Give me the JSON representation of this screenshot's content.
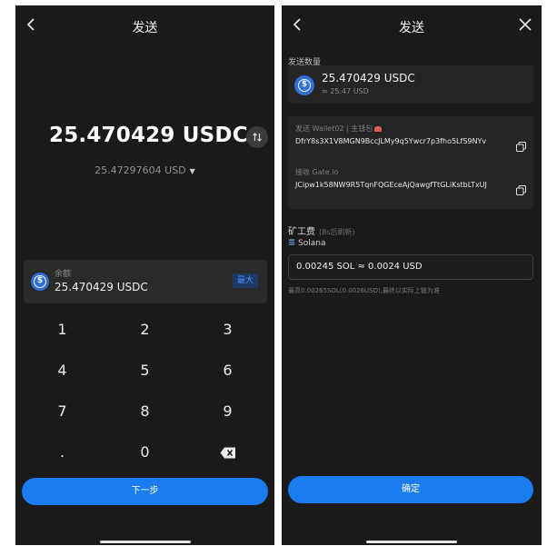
{
  "send_screen": {
    "title": "发送",
    "amount": "25.470429 USDC",
    "fiat_value": "25.47297604 USD",
    "balance_label": "余额",
    "balance_value": "25.470429 USDC",
    "max_label": "最大",
    "keys": [
      "1",
      "2",
      "3",
      "4",
      "5",
      "6",
      "7",
      "8",
      "9",
      ".",
      "0"
    ],
    "next_label": "下一步"
  },
  "confirm_screen": {
    "title": "发送",
    "quantity_label": "发送数量",
    "amount": "25.470429 USDC",
    "fiat_value": "≈ 25.47 USD",
    "from_label": "发送 Wallet02 | 主钱包",
    "from_address": "DfrY8s3X1V8MGN9BccJLMy9q5Ywcr7p3fho5LfS9NYv",
    "to_label": "接收 Gate.io",
    "to_address": "JCipw1k58NW9R5TqnFQGEceAjQawgfTtGLiKstbLTxUJ",
    "fee_label": "矿工费",
    "fee_hint": "(8s后刷新)",
    "network": "Solana",
    "fee_value": "0.00245 SOL ≈ 0.0024 USD",
    "fee_note": "最高0.00265SOL(0.0026USD),最终以实际上链为准",
    "confirm_label": "确定"
  },
  "colors": {
    "background": "#1a1a1a",
    "card": "#252525",
    "accent": "#1a7cf0",
    "usdc": "#2f6fd6"
  },
  "icons": {
    "back": "chevron-left-icon",
    "close": "close-icon",
    "swap": "swap-vertical-icon",
    "delete": "backspace-icon",
    "copy": "copy-icon",
    "token": "usdc-icon",
    "network": "solana-icon"
  }
}
